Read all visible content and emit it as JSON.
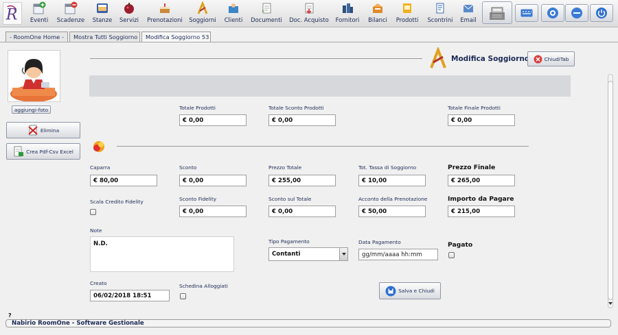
{
  "toolbar": {
    "items": [
      {
        "label": "Eventi",
        "icon": "calendar-plus-icon",
        "color": "#2e9b3a"
      },
      {
        "label": "Scadenze",
        "icon": "calendar-minus-icon",
        "color": "#d63a3a"
      },
      {
        "label": "Stanze",
        "icon": "room-icon",
        "color": "#3a5fa8"
      },
      {
        "label": "Servizi",
        "icon": "services-icon",
        "color": "#9b1d2e"
      },
      {
        "label": "Prenotazioni",
        "icon": "cake-icon",
        "color": "#c98a3c"
      },
      {
        "label": "Soggiorni",
        "icon": "stay-icon",
        "color": "#e0a020"
      },
      {
        "label": "Clienti",
        "icon": "clients-icon",
        "color": "#3a86c8"
      },
      {
        "label": "Documenti",
        "icon": "document-icon",
        "color": "#5a9e3a"
      },
      {
        "label": "Doc. Acquisto",
        "icon": "purchase-document-icon",
        "color": "#d04040"
      },
      {
        "label": "Fornitori",
        "icon": "suppliers-icon",
        "color": "#2d4f7a"
      },
      {
        "label": "Bilanci",
        "icon": "balance-icon",
        "color": "#e08a2a"
      },
      {
        "label": "Prodotti",
        "icon": "products-icon",
        "color": "#f0b020"
      },
      {
        "label": "Scontrini",
        "icon": "receipt-icon",
        "color": "#3a6ab8"
      },
      {
        "label": "Email",
        "icon": "email-icon",
        "color": "#5a8ac8"
      }
    ]
  },
  "tabs": [
    {
      "label": "- RoomOne Home -"
    },
    {
      "label": "Mostra Tutti Soggiorno"
    },
    {
      "label": "Modifica Soggiorno 53"
    }
  ],
  "sidebar": {
    "add_photo": "aggiungi-foto",
    "delete": "Elimina",
    "export": "Crea Pdf-Csv Excel"
  },
  "page": {
    "title": "Modifica Soggiorno",
    "close_tab": "ChiudiTab"
  },
  "products": {
    "totale_prodotti": {
      "label": "Totale Prodotti",
      "value": "€ 0,00"
    },
    "totale_sconto_prodotti": {
      "label": "Totale Sconto Prodotti",
      "value": "€ 0,00"
    },
    "totale_finale_prodotti": {
      "label": "Totale Finale Prodotti",
      "value": "€ 0,00"
    }
  },
  "fields": {
    "caparra": {
      "label": "Caparra",
      "value": "€ 80,00"
    },
    "sconto": {
      "label": "Sconto",
      "value": "€ 0,00"
    },
    "prezzo_totale": {
      "label": "Prezzo Totale",
      "value": "€ 255,00"
    },
    "tassa_soggiorno": {
      "label": "Tot. Tassa di Soggiorno",
      "value": "€ 10,00"
    },
    "prezzo_finale": {
      "label": "Prezzo Finale",
      "value": "€ 265,00"
    },
    "scala_credito": {
      "label": "Scala Credito Fidelity"
    },
    "sconto_fidelity": {
      "label": "Sconto Fidelity",
      "value": "€ 0,00"
    },
    "sconto_totale": {
      "label": "Sconto sul Totale",
      "value": "€ 0,00"
    },
    "acconto": {
      "label": "Acconto della Prenotazione",
      "value": "€ 50,00"
    },
    "importo_da_pagare": {
      "label": "Importo da Pagare",
      "value": "€ 215,00"
    },
    "note": {
      "label": "Note",
      "value": "N.D."
    },
    "tipo_pagamento": {
      "label": "Tipo Pagamento",
      "value": "Contanti"
    },
    "data_pagamento": {
      "label": "Data Pagamento",
      "placeholder": "gg/mm/aaaa hh:mm"
    },
    "pagato": {
      "label": "Pagato"
    },
    "creato": {
      "label": "Creato",
      "value": "06/02/2018 18:51"
    },
    "schedina": {
      "label": "Schedina Alloggiati"
    }
  },
  "actions": {
    "save_close": "Salva e Chiudi"
  },
  "footer": {
    "help": "?",
    "status": "Nabirio RoomOne - Software Gestionale"
  }
}
